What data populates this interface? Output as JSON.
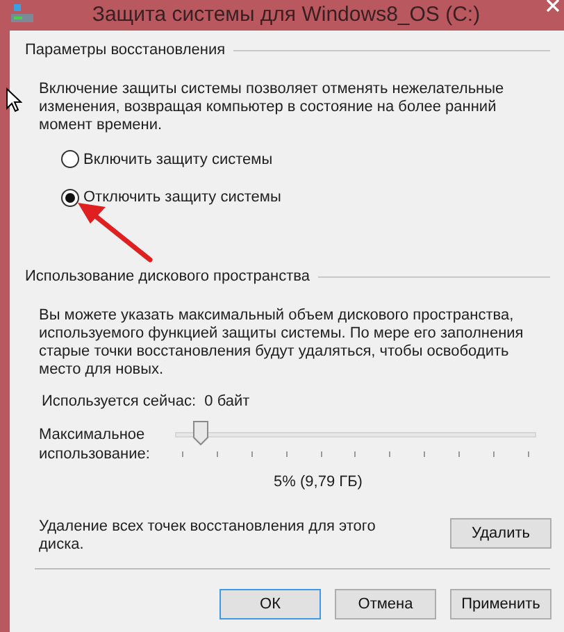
{
  "window": {
    "title": "Защита системы для Windows8_OS (C:)"
  },
  "restore_settings": {
    "heading": "Параметры восстановления",
    "description": "Включение защиты системы позволяет отменять нежелательные изменения, возвращая компьютер в состояние на более ранний момент времени.",
    "options": [
      {
        "label": "Включить защиту системы",
        "selected": false
      },
      {
        "label": "Отключить защиту системы",
        "selected": true
      }
    ]
  },
  "disk_usage": {
    "heading": "Использование дискового пространства",
    "description": "Вы можете указать максимальный объем дискового пространства, используемого функцией защиты системы. По мере его заполнения старые точки восстановления будут удаляться, чтобы освободить место для новых.",
    "current_usage": "Используется сейчас:  0 байт",
    "max_usage_label": "Максимальное использование:",
    "max_usage": {
      "level": 0.05
    },
    "max_usage_reading": "5% (9,79 ГБ)",
    "delete_text": "Удаление всех точек восстановления для этого диска.",
    "delete_button": "Удалить"
  },
  "buttons": [
    {
      "label": "ОК",
      "default": true
    },
    {
      "label": "Отмена",
      "default": false
    },
    {
      "label": "Применить",
      "default": false
    }
  ]
}
